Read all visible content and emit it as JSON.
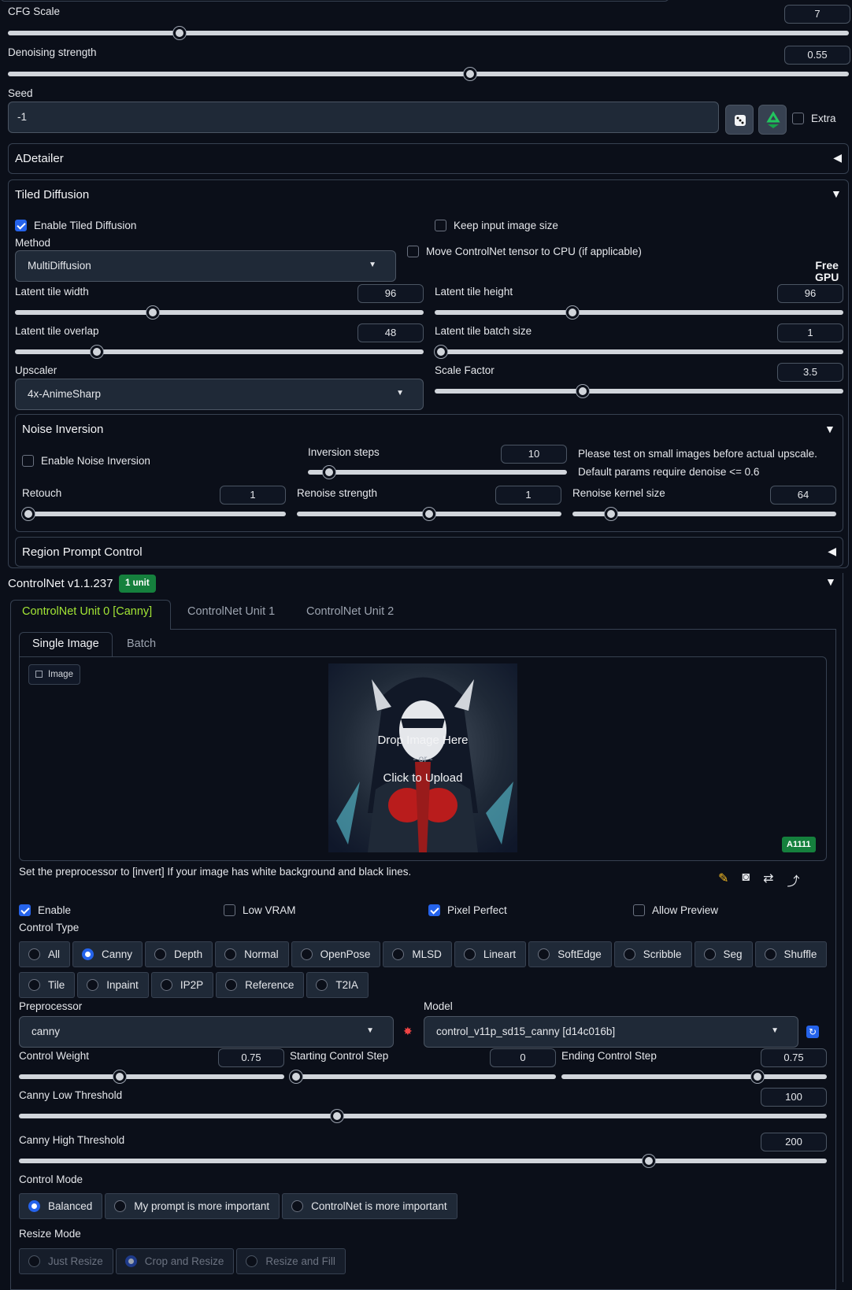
{
  "cfg": {
    "label": "CFG Scale",
    "value": "7",
    "fraction": 0.2
  },
  "denoise": {
    "label": "Denoising strength",
    "value": "0.55",
    "fraction": 0.55
  },
  "seed": {
    "label": "Seed",
    "value": "-1",
    "extra_label": "Extra",
    "dice_icon": "dice-icon",
    "recycle_icon": "recycle-icon"
  },
  "adetailer": {
    "title": "ADetailer"
  },
  "tiled": {
    "title": "Tiled Diffusion",
    "enable_label": "Enable Tiled Diffusion",
    "keep_label": "Keep input image size",
    "move_label": "Move ControlNet tensor to CPU (if applicable)",
    "free_gpu_line1": "Free",
    "free_gpu_line2": "GPU",
    "method_label": "Method",
    "method_value": "MultiDiffusion",
    "tile_width": {
      "label": "Latent tile width",
      "value": "96",
      "fraction": 0.333
    },
    "tile_height": {
      "label": "Latent tile height",
      "value": "96",
      "fraction": 0.333
    },
    "tile_overlap": {
      "label": "Latent tile overlap",
      "value": "48",
      "fraction": 0.19
    },
    "tile_batch": {
      "label": "Latent tile batch size",
      "value": "1",
      "fraction": 0.0
    },
    "upscaler_label": "Upscaler",
    "upscaler_value": "4x-AnimeSharp",
    "scale": {
      "label": "Scale Factor",
      "value": "3.5",
      "fraction": 0.357
    },
    "noise": {
      "title": "Noise Inversion",
      "enable_label": "Enable Noise Inversion",
      "steps": {
        "label": "Inversion steps",
        "value": "10",
        "fraction": 0.06
      },
      "note1": "Please test on small images before actual upscale.",
      "note2": "Default params require denoise <= 0.6",
      "retouch": {
        "label": "Retouch",
        "value": "1",
        "fraction": 0.0
      },
      "renoise": {
        "label": "Renoise strength",
        "value": "1",
        "fraction": 0.5
      },
      "kernel": {
        "label": "Renoise kernel size",
        "value": "64",
        "fraction": 0.13
      }
    },
    "region": {
      "title": "Region Prompt Control"
    }
  },
  "controlnet": {
    "title": "ControlNet v1.1.237",
    "badge": "1 unit",
    "tabs": [
      "ControlNet Unit 0 [Canny]",
      "ControlNet Unit 1",
      "ControlNet Unit 2"
    ],
    "subtabs": [
      "Single Image",
      "Batch"
    ],
    "image_label": "Image",
    "drop_text1": "Drop Image Here",
    "drop_text2": "- or -",
    "drop_text3": "Click to Upload",
    "a1111": "A1111",
    "hint": "Set the preprocessor to [invert] If your image has white background and black lines.",
    "enable_label": "Enable",
    "lowvram_label": "Low VRAM",
    "pixel_label": "Pixel Perfect",
    "preview_label": "Allow Preview",
    "control_type_label": "Control Type",
    "types_row1": [
      "All",
      "Canny",
      "Depth",
      "Normal",
      "OpenPose",
      "MLSD",
      "Lineart",
      "SoftEdge",
      "Scribble",
      "Seg",
      "Shuffle"
    ],
    "types_row2": [
      "Tile",
      "Inpaint",
      "IP2P",
      "Reference",
      "T2IA"
    ],
    "selected_type": "Canny",
    "preproc_label": "Preprocessor",
    "preproc_value": "canny",
    "model_label": "Model",
    "model_value": "control_v11p_sd15_canny [d14c016b]",
    "weight": {
      "label": "Control Weight",
      "value": "0.75",
      "fraction": 0.375
    },
    "start": {
      "label": "Starting Control Step",
      "value": "0",
      "fraction": 0.0
    },
    "end": {
      "label": "Ending Control Step",
      "value": "0.75",
      "fraction": 0.75
    },
    "low": {
      "label": "Canny Low Threshold",
      "value": "100",
      "fraction": 0.392
    },
    "high": {
      "label": "Canny High Threshold",
      "value": "200",
      "fraction": 0.784
    },
    "mode_label": "Control Mode",
    "modes": [
      "Balanced",
      "My prompt is more important",
      "ControlNet is more important"
    ],
    "resize_label": "Resize Mode",
    "resizes": [
      "Just Resize",
      "Crop and Resize",
      "Resize and Fill"
    ]
  }
}
